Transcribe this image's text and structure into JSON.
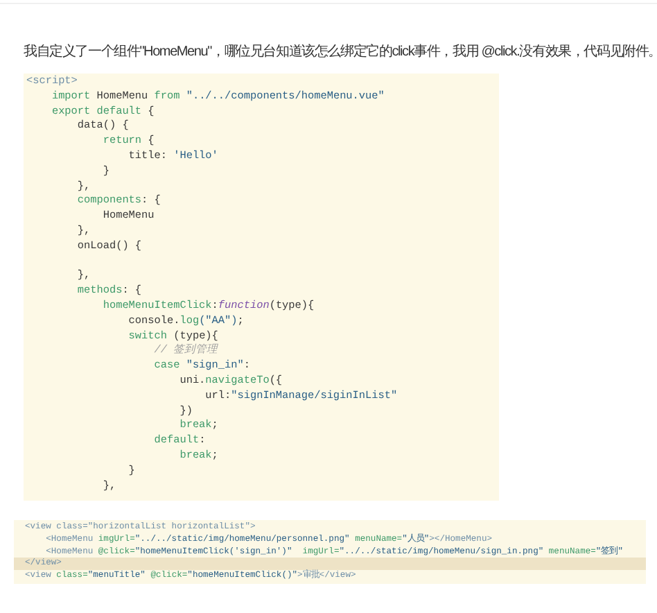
{
  "question": "我自定义了一个组件\"HomeMenu\"，哪位兄台知道该怎么绑定它的click事件，我用 @click.没有效果，代码见附件。",
  "code_image": {
    "lines": [
      [
        {
          "kind": "tag",
          "text": "<script>"
        }
      ],
      [
        {
          "kind": "kw",
          "text": "    import"
        },
        {
          "kind": "plain",
          "text": " HomeMenu "
        },
        {
          "kind": "kw",
          "text": "from"
        },
        {
          "kind": "str",
          "text": " \"../../components/homeMenu.vue\""
        }
      ],
      [
        {
          "kind": "kw",
          "text": "    export default"
        },
        {
          "kind": "plain",
          "text": " {"
        }
      ],
      [
        {
          "kind": "plain",
          "text": "        data() {"
        }
      ],
      [
        {
          "kind": "kw",
          "text": "            return"
        },
        {
          "kind": "plain",
          "text": " {"
        }
      ],
      [
        {
          "kind": "plain",
          "text": "                title: "
        },
        {
          "kind": "str",
          "text": "'Hello'"
        }
      ],
      [
        {
          "kind": "plain",
          "text": "            }"
        }
      ],
      [
        {
          "kind": "plain",
          "text": "        },"
        }
      ],
      [
        {
          "kind": "kw",
          "text": "        components"
        },
        {
          "kind": "plain",
          "text": ": {"
        }
      ],
      [
        {
          "kind": "plain",
          "text": "            HomeMenu"
        }
      ],
      [
        {
          "kind": "plain",
          "text": "        },"
        }
      ],
      [
        {
          "kind": "plain",
          "text": "        onLoad() {"
        }
      ],
      [
        {
          "kind": "plain",
          "text": "\n        },"
        }
      ],
      [
        {
          "kind": "kw",
          "text": "        methods"
        },
        {
          "kind": "plain",
          "text": ": {"
        }
      ],
      [
        {
          "kind": "kw",
          "text": "            homeMenuItemClick"
        },
        {
          "kind": "plain",
          "text": ":"
        },
        {
          "kind": "fn",
          "text": "function"
        },
        {
          "kind": "plain",
          "text": "(type){"
        }
      ],
      [
        {
          "kind": "plain",
          "text": "                console."
        },
        {
          "kind": "kw",
          "text": "log"
        },
        {
          "kind": "str",
          "text": "(\"AA\")"
        },
        {
          "kind": "plain",
          "text": ";"
        }
      ],
      [
        {
          "kind": "kw",
          "text": "                switch"
        },
        {
          "kind": "plain",
          "text": " (type){"
        }
      ],
      [
        {
          "kind": "cmt",
          "text": "                    // 签到管理"
        }
      ],
      [
        {
          "kind": "kw",
          "text": "                    case"
        },
        {
          "kind": "str",
          "text": " \"sign_in\""
        },
        {
          "kind": "plain",
          "text": ":"
        }
      ],
      [
        {
          "kind": "plain",
          "text": "                        uni."
        },
        {
          "kind": "kw",
          "text": "navigateTo"
        },
        {
          "kind": "plain",
          "text": "({"
        }
      ],
      [
        {
          "kind": "plain",
          "text": "                            url:"
        },
        {
          "kind": "str",
          "text": "\"signInManage/siginInList\""
        }
      ],
      [
        {
          "kind": "plain",
          "text": "                        })"
        }
      ],
      [
        {
          "kind": "kw",
          "text": "                        break"
        },
        {
          "kind": "plain",
          "text": ";"
        }
      ],
      [
        {
          "kind": "kw",
          "text": "                    default"
        },
        {
          "kind": "plain",
          "text": ":"
        }
      ],
      [
        {
          "kind": "kw",
          "text": "                        break"
        },
        {
          "kind": "plain",
          "text": ";"
        }
      ],
      [
        {
          "kind": "plain",
          "text": "                }"
        }
      ],
      [
        {
          "kind": "plain",
          "text": "            },"
        }
      ]
    ]
  },
  "template_image": {
    "lines": [
      {
        "highlighted": false,
        "segments": [
          {
            "kind": "tag",
            "text": "<view class=\"horizontalList horizontalList\">"
          }
        ]
      },
      {
        "highlighted": false,
        "segments": [
          {
            "kind": "tag",
            "text": "    <HomeMenu"
          },
          {
            "kind": "kw",
            "text": " imgUrl="
          },
          {
            "kind": "str",
            "text": "\"../../static/img/homeMenu/personnel.png\""
          },
          {
            "kind": "kw",
            "text": " menuName="
          },
          {
            "kind": "str",
            "text": "\"人员\""
          },
          {
            "kind": "tag",
            "text": "></HomeMenu>"
          }
        ]
      },
      {
        "highlighted": false,
        "segments": [
          {
            "kind": "tag",
            "text": "    <HomeMenu"
          },
          {
            "kind": "kw",
            "text": " @click="
          },
          {
            "kind": "str",
            "text": "\"homeMenuItemClick('sign_in')\""
          },
          {
            "kind": "kw",
            "text": "  imgUrl="
          },
          {
            "kind": "str",
            "text": "\"../../static/img/homeMenu/sign_in.png\""
          },
          {
            "kind": "kw",
            "text": " menuName="
          },
          {
            "kind": "str",
            "text": "\"签到\""
          }
        ]
      },
      {
        "highlighted": true,
        "segments": [
          {
            "kind": "tag",
            "text": "</view>"
          }
        ]
      },
      {
        "highlighted": false,
        "segments": [
          {
            "kind": "tag",
            "text": "<view"
          },
          {
            "kind": "kw",
            "text": " class="
          },
          {
            "kind": "str",
            "text": "\"menuTitle\""
          },
          {
            "kind": "kw",
            "text": " @click="
          },
          {
            "kind": "str",
            "text": "\"homeMenuItemClick()\""
          },
          {
            "kind": "tag",
            "text": ">审批</view>"
          }
        ]
      }
    ]
  }
}
